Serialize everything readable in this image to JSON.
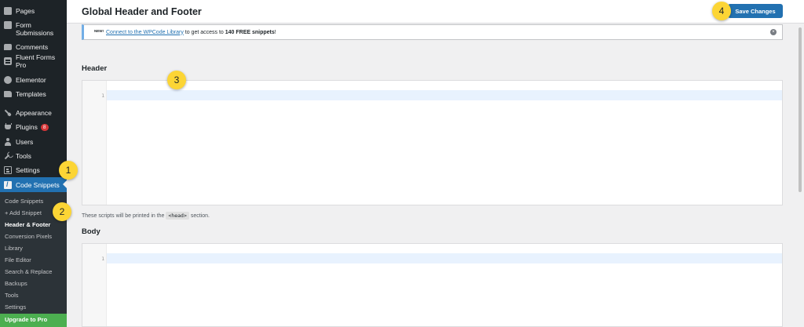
{
  "sidebar": {
    "items": [
      {
        "label": "Pages",
        "icon": "pages-icon"
      },
      {
        "label": "Form",
        "label2": "Submissions",
        "icon": "form-submissions-icon"
      },
      {
        "label": "Comments",
        "icon": "comments-icon"
      },
      {
        "label": "Fluent Forms Pro",
        "icon": "fluent-forms-icon"
      },
      {
        "label": "Elementor",
        "icon": "elementor-icon"
      },
      {
        "label": "Templates",
        "icon": "templates-icon"
      },
      {
        "label": "Appearance",
        "icon": "appearance-icon"
      },
      {
        "label": "Plugins",
        "icon": "plugins-icon",
        "badge": "8"
      },
      {
        "label": "Users",
        "icon": "users-icon"
      },
      {
        "label": "Tools",
        "icon": "tools-icon"
      },
      {
        "label": "Settings",
        "icon": "settings-icon"
      },
      {
        "label": "Code Snippets",
        "icon": "code-snippets-icon"
      }
    ],
    "submenu": [
      "Code Snippets",
      "+ Add Snippet",
      "Header & Footer",
      "Conversion Pixels",
      "Library",
      "File Editor",
      "Search & Replace",
      "Backups",
      "Tools",
      "Settings"
    ],
    "upgrade": "Upgrade to Pro"
  },
  "header": {
    "title": "Global Header and Footer",
    "save_label": "Save Changes"
  },
  "notice": {
    "new_tag": "NEW!",
    "link_text": "Connect to the WPCode Library",
    "middle_text": " to get access to ",
    "bold_text": "140 FREE snippets",
    "end_text": "!"
  },
  "header_section": {
    "label": "Header",
    "line_number": "1",
    "help_prefix": "These scripts will be printed in the ",
    "help_code": "<head>",
    "help_suffix": " section."
  },
  "body_section": {
    "label": "Body",
    "line_number": "1"
  },
  "callouts": [
    "1",
    "2",
    "3",
    "4"
  ],
  "colors": {
    "accent": "#2271b1",
    "sidebar": "#1d2327",
    "callout": "#fcd535",
    "upgrade": "#4caf50",
    "badge": "#d63638"
  }
}
